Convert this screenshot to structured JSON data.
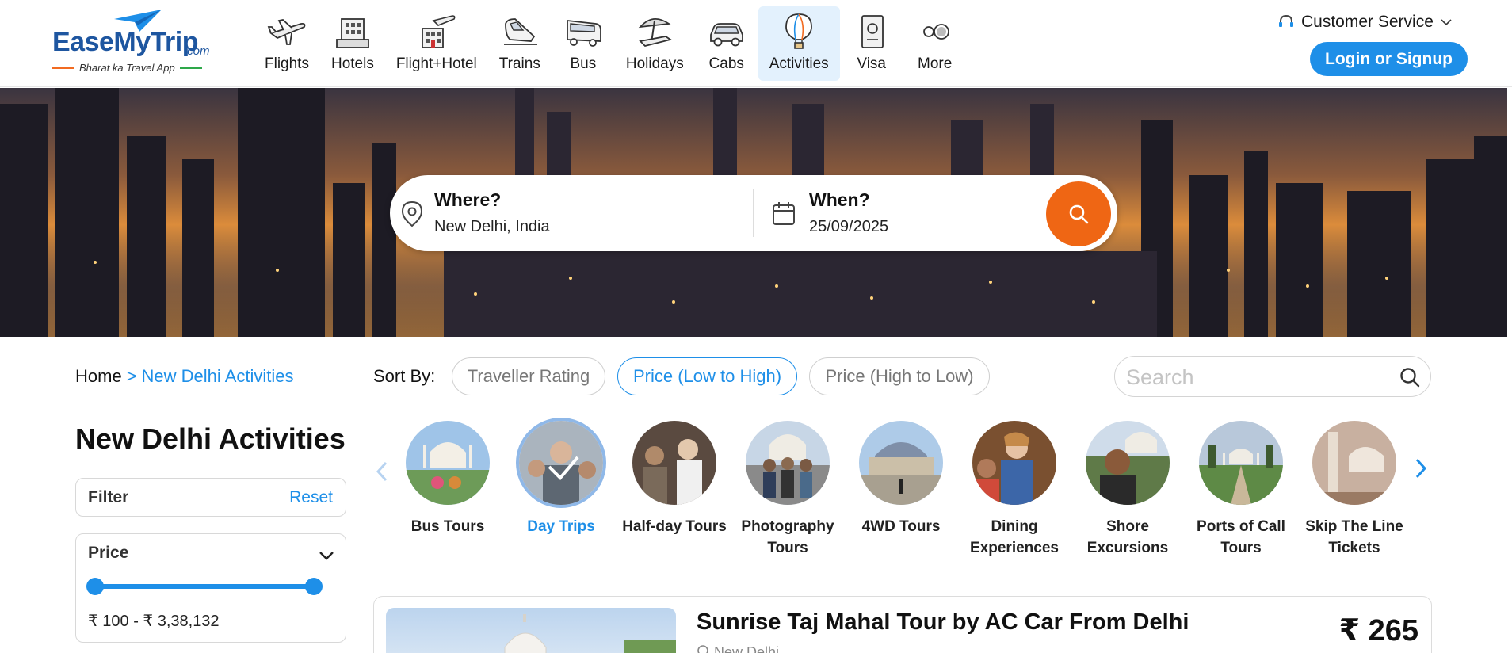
{
  "brand": {
    "name": "EaseMyTrip",
    "suffix": ".com",
    "tagline": "Bharat ka Travel App",
    "colors": {
      "primary": "#1e56a0",
      "accent": "#1e8fe8",
      "orange": "#ef6614",
      "green": "#2ea84a"
    }
  },
  "nav": {
    "items": [
      {
        "label": "Flights",
        "icon": "airplane-icon"
      },
      {
        "label": "Hotels",
        "icon": "hotel-icon"
      },
      {
        "label": "Flight+Hotel",
        "icon": "flight-hotel-icon"
      },
      {
        "label": "Trains",
        "icon": "train-icon"
      },
      {
        "label": "Bus",
        "icon": "bus-icon"
      },
      {
        "label": "Holidays",
        "icon": "beach-umbrella-icon"
      },
      {
        "label": "Cabs",
        "icon": "car-icon"
      },
      {
        "label": "Activities",
        "icon": "hot-air-balloon-icon",
        "active": true
      },
      {
        "label": "Visa",
        "icon": "passport-icon"
      },
      {
        "label": "More",
        "icon": "more-icon"
      }
    ]
  },
  "header": {
    "customer_service": "Customer Service",
    "login_label": "Login or Signup"
  },
  "search": {
    "where_title": "Where?",
    "where_value": "New Delhi, India",
    "when_title": "When?",
    "when_value": "25/09/2025"
  },
  "breadcrumb": {
    "home": "Home",
    "separator": ">",
    "current": "New Delhi Activities"
  },
  "sort": {
    "label": "Sort By:",
    "options": [
      {
        "label": "Traveller Rating",
        "active": false
      },
      {
        "label": "Price (Low to High)",
        "active": true
      },
      {
        "label": "Price (High to Low)",
        "active": false
      }
    ]
  },
  "list_search": {
    "placeholder": "Search"
  },
  "page_title": "New Delhi Activities",
  "filter": {
    "title": "Filter",
    "reset_label": "Reset"
  },
  "price_filter": {
    "title": "Price",
    "range_label": "₹ 100 - ₹ 3,38,132",
    "min_fraction": 0,
    "max_fraction": 1
  },
  "categories": [
    {
      "label": "Bus Tours",
      "active": false
    },
    {
      "label": "Day Trips",
      "active": true
    },
    {
      "label": "Half-day Tours",
      "active": false
    },
    {
      "label": "Photography Tours",
      "active": false
    },
    {
      "label": "4WD Tours",
      "active": false
    },
    {
      "label": "Dining Experiences",
      "active": false
    },
    {
      "label": "Shore Excursions",
      "active": false
    },
    {
      "label": "Ports of Call Tours",
      "active": false
    },
    {
      "label": "Skip The Line Tickets",
      "active": false
    }
  ],
  "results": [
    {
      "title": "Sunrise Taj Mahal Tour by AC Car From Delhi",
      "location": "New Delhi",
      "price": "₹ 265"
    }
  ]
}
